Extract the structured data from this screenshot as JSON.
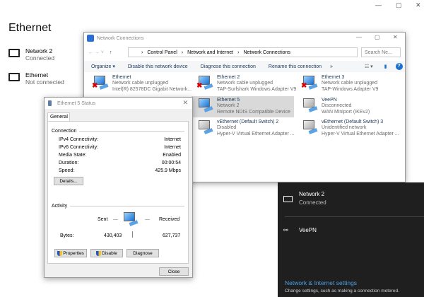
{
  "settings": {
    "title": "Ethernet",
    "items": [
      {
        "name": "Network 2",
        "status": "Connected"
      },
      {
        "name": "Ethernet",
        "status": "Not connected"
      }
    ],
    "window_controls": [
      "—",
      "▢",
      "✕"
    ]
  },
  "netconn": {
    "title": "Network Connections",
    "breadcrumb": [
      "Control Panel",
      "Network and Internet",
      "Network Connections"
    ],
    "search_placeholder": "Search Ne...",
    "toolbar": [
      "Organize ▾",
      "Disable this network device",
      "Diagnose this connection",
      "Rename this connection",
      "»"
    ],
    "items": [
      {
        "name": "Ethernet",
        "status": "Network cable unplugged",
        "device": "Intel(R) 82578DC Gigabit Network...",
        "unplugged": true
      },
      {
        "name": "Ethernet 2",
        "status": "Network cable unplugged",
        "device": "TAP-Surfshark Windows Adapter V9",
        "unplugged": true
      },
      {
        "name": "Ethernet 3",
        "status": "Network cable unplugged",
        "device": "TAP-Windows Adapter V9",
        "unplugged": true
      },
      {
        "name": "Ethernet 5",
        "status": "Network 2",
        "device": "Remote NDIS Compatible Device",
        "selected": true
      },
      {
        "name": "VeePN",
        "status": "Disconnected",
        "device": "WAN Miniport (IKEv2)"
      },
      {
        "name": "vEthernet (Default Switch) 2",
        "status": "Disabled",
        "device": "Hyper-V Virtual Ethernet Adapter ..."
      },
      {
        "name": "vEthernet (Default Switch) 3",
        "status": "Unidentified network",
        "device": "Hyper-V Virtual Ethernet Adapter ..."
      }
    ]
  },
  "status": {
    "title": "Ethernet 5 Status",
    "tab": "General",
    "connection_label": "Connection",
    "rows": [
      [
        "IPv4 Connectivity:",
        "Internet"
      ],
      [
        "IPv6 Connectivity:",
        "Internet"
      ],
      [
        "Media State:",
        "Enabled"
      ],
      [
        "Duration:",
        "00:00:54"
      ],
      [
        "Speed:",
        "425.9 Mbps"
      ]
    ],
    "details": "Details...",
    "activity_label": "Activity",
    "sent": "Sent",
    "received": "Received",
    "bytes_label": "Bytes:",
    "bytes_sent": "430,403",
    "bytes_received": "627,737",
    "properties": "Properties",
    "disable": "Disable",
    "diagnose": "Diagnose",
    "close": "Close"
  },
  "flyout": {
    "network": "Network 2",
    "network_status": "Connected",
    "vpn": "VeePN",
    "settings_link": "Network & Internet settings",
    "settings_desc": "Change settings, such as making a connection metered.",
    "link_color": "#4aa0e6"
  }
}
